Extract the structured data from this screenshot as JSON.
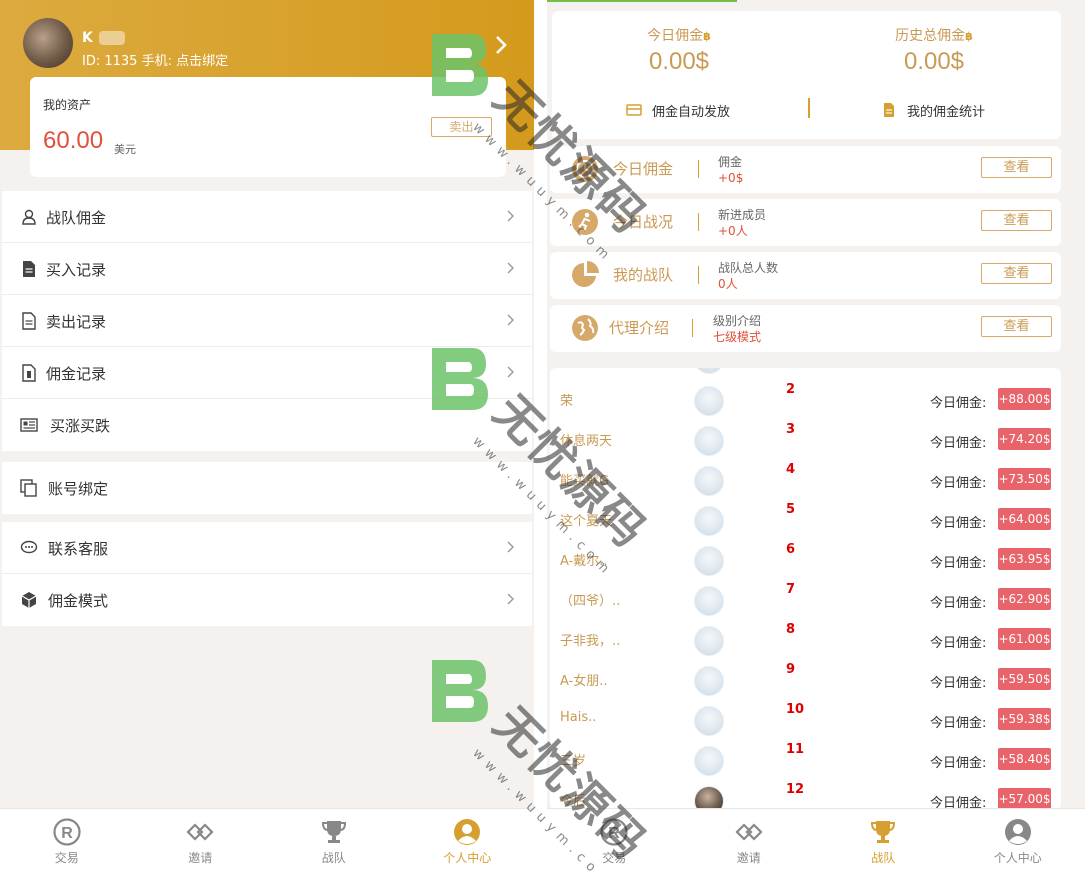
{
  "left": {
    "profile": {
      "name": "K",
      "id_line": "ID: 1135 手机: 点击绑定"
    },
    "assets": {
      "label": "我的资产",
      "amount": "60.00",
      "unit": "美元",
      "sell_label": "卖出"
    },
    "menu_group1": [
      {
        "label": "战队佣金",
        "icon": "user-icon"
      },
      {
        "label": "买入记录",
        "icon": "document-icon"
      },
      {
        "label": "卖出记录",
        "icon": "document-outline-icon"
      },
      {
        "label": "佣金记录",
        "icon": "receipt-icon"
      },
      {
        "label": "买涨买跌",
        "icon": "newspaper-icon"
      }
    ],
    "menu_group2": [
      {
        "label": "账号绑定",
        "icon": "copy-icon"
      }
    ],
    "menu_group3": [
      {
        "label": "联系客服",
        "icon": "chat-icon"
      },
      {
        "label": "佣金模式",
        "icon": "cube-icon"
      }
    ],
    "tabs": [
      {
        "label": "交易",
        "icon": "registered-icon",
        "active": false
      },
      {
        "label": "邀请",
        "icon": "link-icon",
        "active": false
      },
      {
        "label": "战队",
        "icon": "trophy-icon",
        "active": false
      },
      {
        "label": "个人中心",
        "icon": "person-icon",
        "active": true
      }
    ]
  },
  "right": {
    "commission": {
      "today_title": "今日佣金",
      "today_value": "0.00$",
      "total_title": "历史总佣金",
      "total_value": "0.00$",
      "coin_symbol": "฿",
      "auto_label": "佣金自动发放",
      "stats_label": "我的佣金统计"
    },
    "stats": [
      {
        "label": "今日佣金",
        "sub_label": "佣金",
        "sub_value": "+0$",
        "button": "查看",
        "icon": "clock-icon"
      },
      {
        "label": "今日战况",
        "sub_label": "新进成员",
        "sub_value": "+0人",
        "button": "查看",
        "icon": "runner-icon"
      },
      {
        "label": "我的战队",
        "sub_label": "战队总人数",
        "sub_value": "0人",
        "button": "查看",
        "icon": "pie-icon"
      },
      {
        "label": "代理介绍",
        "sub_label": "级别介绍",
        "sub_value": "七级模式",
        "button": "查看",
        "icon": "globe-icon"
      }
    ],
    "ranking_label": "今日佣金:",
    "ranking": [
      {
        "name": "荣",
        "rank": "2",
        "amount": "+88.00$"
      },
      {
        "name": "休息两天",
        "rank": "3",
        "amount": "+74.20$"
      },
      {
        "name": "能买就G",
        "rank": "4",
        "amount": "+73.50$"
      },
      {
        "name": "这个夏天",
        "rank": "5",
        "amount": "+64.00$"
      },
      {
        "name": "A-戴尔..",
        "rank": "6",
        "amount": "+63.95$"
      },
      {
        "name": "（四爷）..",
        "rank": "7",
        "amount": "+62.90$"
      },
      {
        "name": "子非我，..",
        "rank": "8",
        "amount": "+61.00$"
      },
      {
        "name": "A-女朋..",
        "rank": "9",
        "amount": "+59.50$"
      },
      {
        "name": "Hais..",
        "rank": "10",
        "amount": "+59.38$"
      },
      {
        "name": "三岁",
        "rank": "11",
        "amount": "+58.40$"
      },
      {
        "name": "今后",
        "rank": "12",
        "amount": "+57.00$"
      }
    ],
    "tabs": [
      {
        "label": "交易",
        "icon": "registered-icon",
        "active": false
      },
      {
        "label": "邀请",
        "icon": "link-icon",
        "active": false
      },
      {
        "label": "战队",
        "icon": "trophy-icon",
        "active": true
      },
      {
        "label": "个人中心",
        "icon": "person-icon",
        "active": false
      }
    ]
  },
  "watermark": {
    "text": "无忧源码",
    "url": "www.wuuym.com"
  },
  "colors": {
    "gold": "#d6a030",
    "red_badge": "#e8646a",
    "rank_red": "#e00000",
    "amount_red": "#e0503b",
    "background": "#f4f1ee"
  }
}
